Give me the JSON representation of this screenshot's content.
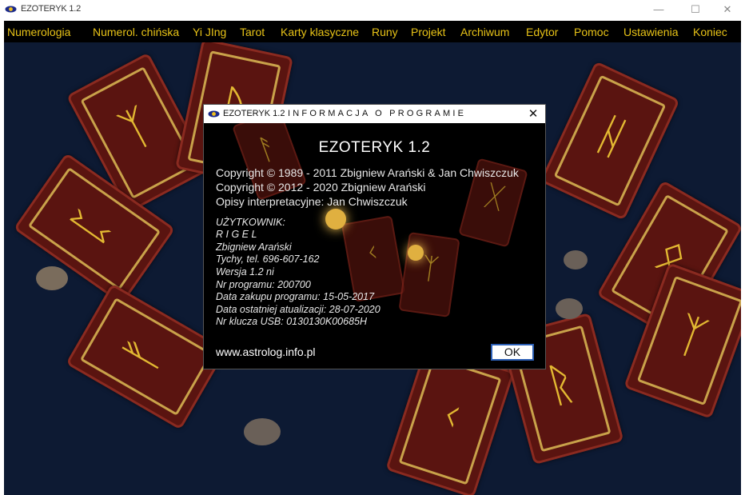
{
  "window": {
    "title": "EZOTERYK 1.2",
    "controls": {
      "minimize": "—",
      "maximize": "☐",
      "close": "✕"
    }
  },
  "menu": [
    "Numerologia",
    "Numerol. chińska",
    "Yi JIng",
    "Tarot",
    "Karty klasyczne",
    "Runy",
    "Projekt",
    "Archiwum",
    "Edytor",
    "Pomoc",
    "Ustawienia",
    "Koniec"
  ],
  "colors": {
    "menu_text": "#e8c317",
    "menu_bg": "#000000",
    "dialog_bg": "#000000",
    "ok_border": "#2c5fb5"
  },
  "dialog": {
    "app_name": "EZOTERYK 1.2",
    "heading": "INFORMACJA O PROGRAMIE",
    "close_glyph": "✕",
    "product": "EZOTERYK  1.2",
    "copyright_lines": [
      "Copyright © 1989 - 2011  Zbigniew Arański & Jan Chwiszczuk",
      "Copyright © 2012 - 2020  Zbigniew Arański",
      "Opisy interpretacyjne: Jan Chwiszczuk"
    ],
    "user_lines": [
      "UŻYTKOWNIK:",
      "R I G E L",
      "Zbigniew Arański",
      "Tychy, tel. 696-607-162",
      "Wersja 1.2 ni",
      "Nr programu: 200700",
      "Data zakupu programu: 15-05-2017",
      "Data ostatniej atualizacji: 28-07-2020",
      "Nr klucza USB: 0130130K00685H"
    ],
    "website": "www.astrolog.info.pl",
    "ok_label": "OK"
  }
}
